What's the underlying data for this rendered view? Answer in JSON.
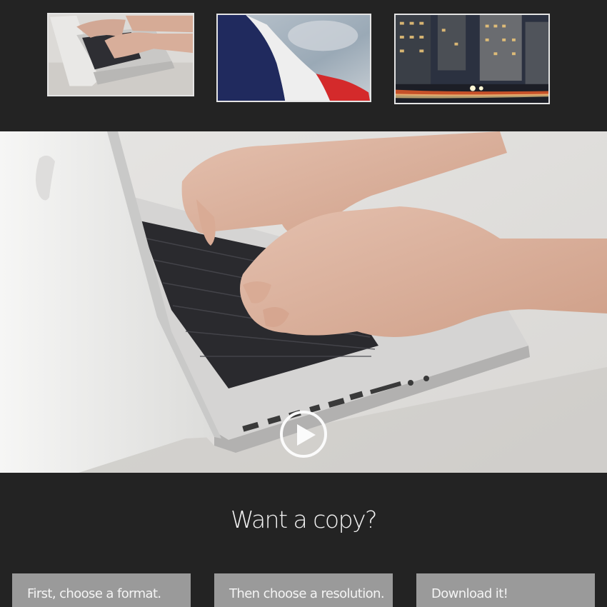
{
  "thumbnails": [
    {
      "subject": "laptop-typing"
    },
    {
      "subject": "french-flag"
    },
    {
      "subject": "city-night-street"
    }
  ],
  "player": {
    "play_icon": "play-icon"
  },
  "download": {
    "heading": "Want a copy?",
    "steps": [
      {
        "label": "First, choose a format."
      },
      {
        "label": "Then choose a resolution."
      },
      {
        "label": "Download it!"
      }
    ]
  },
  "colors": {
    "background": "#232323",
    "button": "#9a9a9a",
    "text": "#f2f2f2"
  }
}
